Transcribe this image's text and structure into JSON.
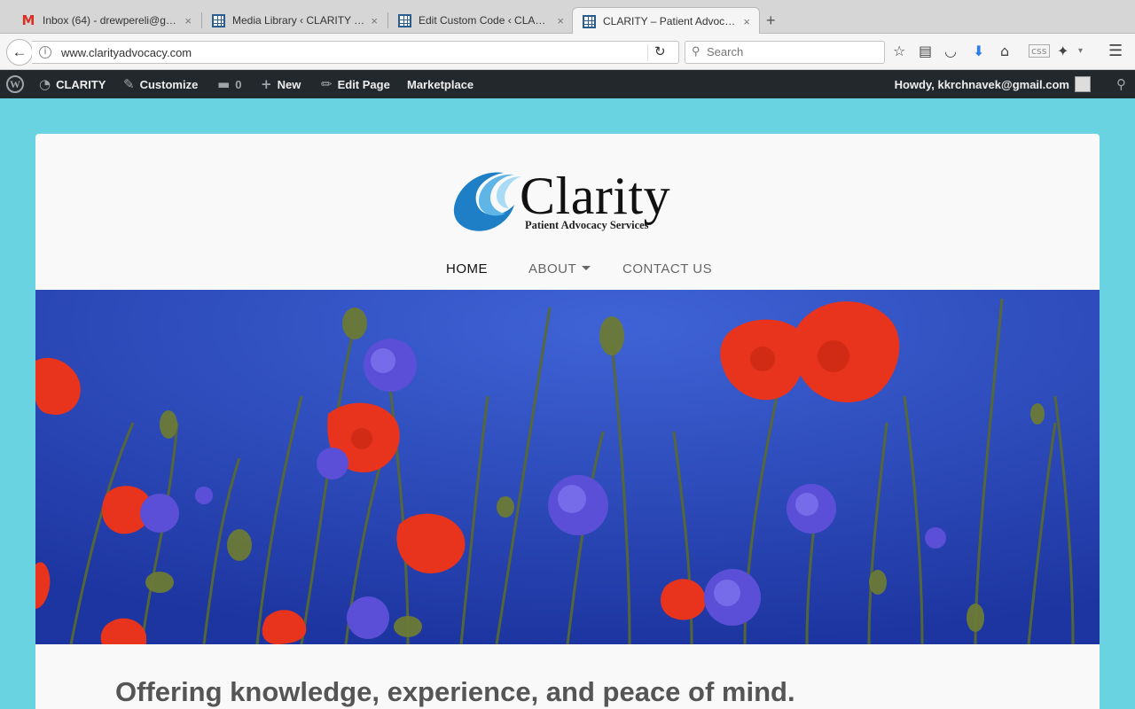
{
  "browser": {
    "tabs": [
      {
        "title": "Inbox (64) - drewpereli@g…",
        "icon": "gmail-icon"
      },
      {
        "title": "Media Library ‹ CLARITY —…",
        "icon": "wordpress-grid-icon"
      },
      {
        "title": "Edit Custom Code ‹ CLARI…",
        "icon": "wordpress-grid-icon"
      },
      {
        "title": "CLARITY – Patient Advocac…",
        "icon": "wordpress-grid-icon",
        "active": true
      }
    ],
    "new_tab": "+",
    "close_glyph": "×",
    "url": "www.clarityadvocacy.com",
    "search_placeholder": "Search"
  },
  "admin_bar": {
    "site_name": "CLARITY",
    "customize": "Customize",
    "comments_count": "0",
    "new": "New",
    "edit_page": "Edit Page",
    "marketplace": "Marketplace",
    "howdy": "Howdy, kkrchnavek@gmail.com"
  },
  "site": {
    "logo_name": "Clarity",
    "logo_tagline": "Patient Advocacy Services",
    "nav": [
      {
        "label": "HOME",
        "active": true
      },
      {
        "label": "ABOUT",
        "dropdown": true
      },
      {
        "label": "CONTACT US"
      }
    ],
    "tagline": "Offering knowledge, experience, and peace of mind."
  },
  "colors": {
    "page_background": "#6ad3e2",
    "admin_bar": "#23282d",
    "sky_blue": "#2a4bc2",
    "poppy_red": "#e8341c",
    "cornflower": "#5b4fd8",
    "logo_blue": "#1f7fc6"
  }
}
